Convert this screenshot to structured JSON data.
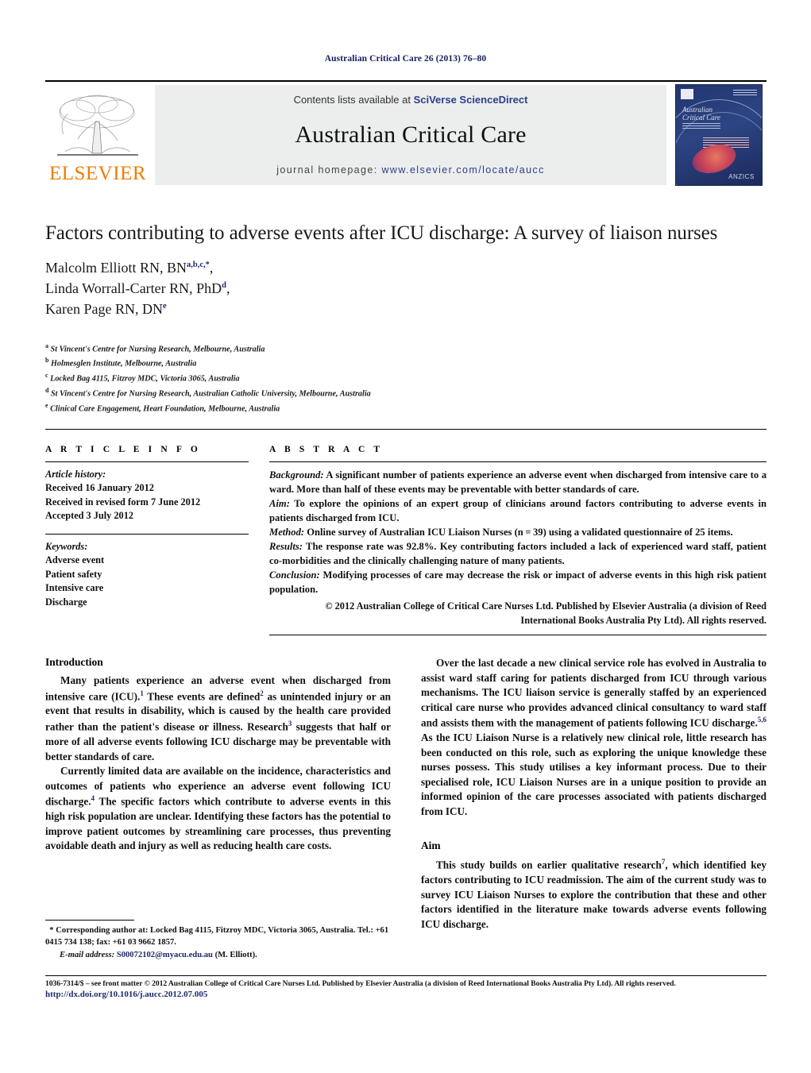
{
  "running_head": "Australian Critical Care 26 (2013) 76–80",
  "masthead": {
    "publisher_name": "ELSEVIER",
    "contents_prefix": "Contents lists available at ",
    "sciencedirect": "SciVerse ScienceDirect",
    "journal_title": "Australian Critical Care",
    "homepage_prefix": "journal homepage: ",
    "homepage_url": "www.elsevier.com/locate/aucc",
    "cover": {
      "title_line1": "Australian",
      "title_line2": "Critical Care",
      "logo": "ANZICS"
    },
    "accent_orange": "#f07d00",
    "accent_blue": "#2b3f8c"
  },
  "article": {
    "title": "Factors contributing to adverse events after ICU discharge: A survey of liaison nurses",
    "authors": [
      {
        "name": "Malcolm Elliott RN, BN",
        "sup": "a,b,c,*",
        "trailing": ","
      },
      {
        "name": "Linda Worrall-Carter RN, PhD",
        "sup": "d",
        "trailing": ","
      },
      {
        "name": "Karen Page RN, DN",
        "sup": "e",
        "trailing": ""
      }
    ],
    "affiliations": [
      {
        "marker": "a",
        "text": "St Vincent's Centre for Nursing Research, Melbourne, Australia"
      },
      {
        "marker": "b",
        "text": "Holmesglen Institute, Melbourne, Australia"
      },
      {
        "marker": "c",
        "text": "Locked Bag 4115, Fitzroy MDC, Victoria 3065, Australia"
      },
      {
        "marker": "d",
        "text": "St Vincent's Centre for Nursing Research, Australian Catholic University, Melbourne, Australia"
      },
      {
        "marker": "e",
        "text": "Clinical Care Engagement, Heart Foundation, Melbourne, Australia"
      }
    ]
  },
  "article_info": {
    "label": "A R T I C L E    I N F O",
    "history_label": "Article history:",
    "history": [
      "Received 16 January 2012",
      "Received in revised form 7 June 2012",
      "Accepted 3 July 2012"
    ],
    "keywords_label": "Keywords:",
    "keywords": [
      "Adverse event",
      "Patient safety",
      "Intensive care",
      "Discharge"
    ]
  },
  "abstract": {
    "label": "A B S T R A C T",
    "sections": [
      {
        "lead": "Background:",
        "text": " A significant number of patients experience an adverse event when discharged from intensive care to a ward. More than half of these events may be preventable with better standards of care."
      },
      {
        "lead": "Aim:",
        "text": " To explore the opinions of an expert group of clinicians around factors contributing to adverse events in patients discharged from ICU."
      },
      {
        "lead": "Method:",
        "text": " Online survey of Australian ICU Liaison Nurses (n = 39) using a validated questionnaire of 25 items."
      },
      {
        "lead": "Results:",
        "text": " The response rate was 92.8%. Key contributing factors included a lack of experienced ward staff, patient co-morbidities and the clinically challenging nature of many patients."
      },
      {
        "lead": "Conclusion:",
        "text": " Modifying processes of care may decrease the risk or impact of adverse events in this high risk patient population."
      }
    ],
    "copyright": "© 2012 Australian College of Critical Care Nurses Ltd. Published by Elsevier Australia (a division of Reed International Books Australia Pty Ltd). All rights reserved."
  },
  "body": {
    "left": {
      "heading_introduction": "Introduction",
      "para1_a": "Many patients experience an adverse event when discharged from intensive care (ICU).",
      "para1_sup1": "1",
      "para1_b": " These events are defined",
      "para1_sup2": "2",
      "para1_c": " as unintended injury or an event that results in disability, which is caused by the health care provided rather than the patient's disease or illness. Research",
      "para1_sup3": "3",
      "para1_d": " suggests that half or more of all adverse events following ICU discharge may be preventable with better standards of care.",
      "para2_a": "Currently limited data are available on the incidence, characteristics and outcomes of patients who experience an adverse event following ICU discharge.",
      "para2_sup4": "4",
      "para2_b": " The specific factors which contribute to adverse events in this high risk population are unclear. Identifying these factors has the potential to improve patient outcomes by streamlining care processes, thus preventing avoidable death and injury as well as reducing health care costs."
    },
    "right": {
      "para1_a": "Over the last decade a new clinical service role has evolved in Australia to assist ward staff caring for patients discharged from ICU through various mechanisms. The ICU liaison service is generally staffed by an experienced critical care nurse who provides advanced clinical consultancy to ward staff and assists them with the management of patients following ICU discharge.",
      "para1_sup56": "5,6",
      "para1_b": " As the ICU Liaison Nurse is a relatively new clinical role, little research has been conducted on this role, such as exploring the unique knowledge these nurses possess. This study utilises a key informant process. Due to their specialised role, ICU Liaison Nurses are in a unique position to provide an informed opinion of the care processes associated with patients discharged from ICU.",
      "heading_aim": "Aim",
      "para2_a": "This study builds on earlier qualitative research",
      "para2_sup7": "7",
      "para2_b": ", which identified key factors contributing to ICU readmission. The aim of the current study was to survey ICU Liaison Nurses to explore the contribution that these and other factors identified in the literature make towards adverse events following ICU discharge."
    }
  },
  "footnote": {
    "star": "*",
    "corresponding": " Corresponding author at: Locked Bag 4115, Fitzroy MDC, Victoria 3065, Australia. Tel.: +61 0415 734 138; fax: +61 03 9662 1857.",
    "email_label": "E-mail address:",
    "email": "S00072102@myacu.edu.au",
    "email_owner": " (M. Elliott)."
  },
  "page_footer": {
    "copyright_line": "1036-7314/$ – see front matter © 2012 Australian College of Critical Care Nurses Ltd. Published by Elsevier Australia (a division of Reed International Books Australia Pty Ltd). All rights reserved.",
    "doi": "http://dx.doi.org/10.1016/j.aucc.2012.07.005"
  }
}
